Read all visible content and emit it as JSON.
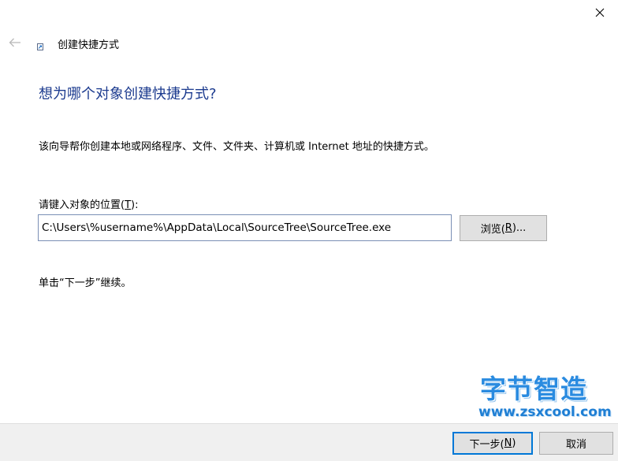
{
  "window": {
    "title": "创建快捷方式",
    "close_glyph": "✕",
    "back_icon": "back-arrow-icon",
    "title_icon": "shortcut-icon"
  },
  "content": {
    "heading": "想为哪个对象创建快捷方式?",
    "description": "该向导帮你创建本地或网络程序、文件、文件夹、计算机或 Internet 地址的快捷方式。",
    "location_label": "请键入对象的位置(",
    "location_label_key": "T",
    "location_label_end": "):",
    "location_value": "C:\\Users\\%username%\\AppData\\Local\\SourceTree\\SourceTree.exe",
    "browse_label": "浏览(",
    "browse_key": "R",
    "browse_end": ")...",
    "hint": "单击“下一步”继续。"
  },
  "footer": {
    "next_label": "下一步(",
    "next_key": "N",
    "next_end": ")",
    "cancel_label": "取消"
  },
  "watermark": {
    "cn_text": "字节智造",
    "url": "www.zsxcool.com"
  },
  "colors": {
    "heading": "#1c3b8f",
    "accent": "#0078d7",
    "watermark": "#2a8be0"
  }
}
